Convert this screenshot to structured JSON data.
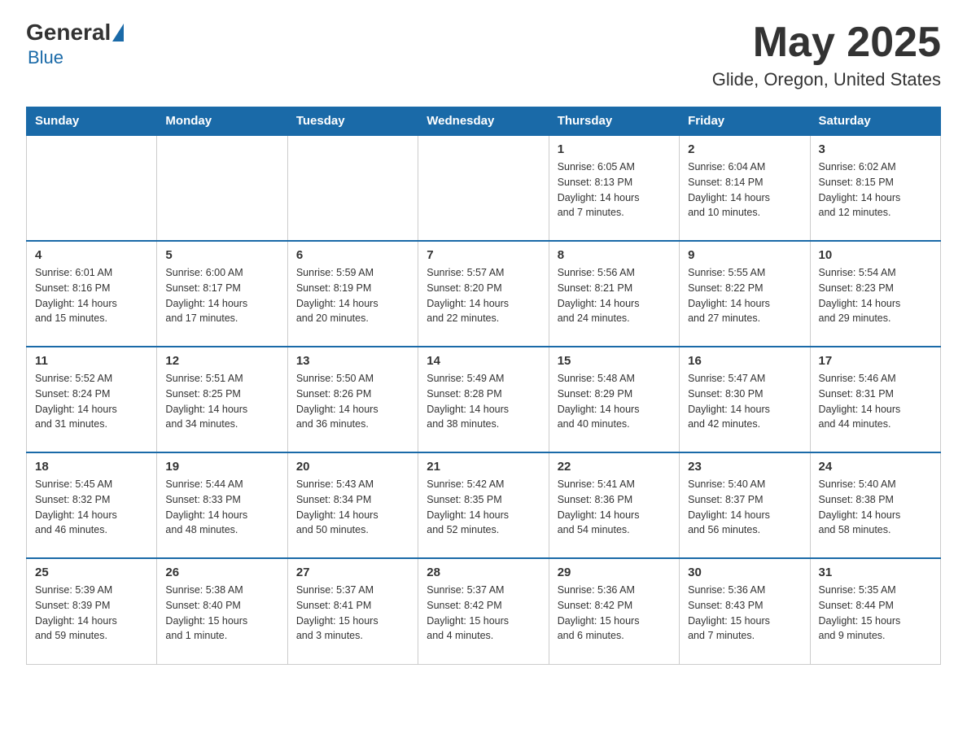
{
  "header": {
    "logo_general": "General",
    "logo_blue": "Blue",
    "month_title": "May 2025",
    "location": "Glide, Oregon, United States"
  },
  "days_of_week": [
    "Sunday",
    "Monday",
    "Tuesday",
    "Wednesday",
    "Thursday",
    "Friday",
    "Saturday"
  ],
  "weeks": [
    [
      {
        "day": "",
        "info": ""
      },
      {
        "day": "",
        "info": ""
      },
      {
        "day": "",
        "info": ""
      },
      {
        "day": "",
        "info": ""
      },
      {
        "day": "1",
        "info": "Sunrise: 6:05 AM\nSunset: 8:13 PM\nDaylight: 14 hours\nand 7 minutes."
      },
      {
        "day": "2",
        "info": "Sunrise: 6:04 AM\nSunset: 8:14 PM\nDaylight: 14 hours\nand 10 minutes."
      },
      {
        "day": "3",
        "info": "Sunrise: 6:02 AM\nSunset: 8:15 PM\nDaylight: 14 hours\nand 12 minutes."
      }
    ],
    [
      {
        "day": "4",
        "info": "Sunrise: 6:01 AM\nSunset: 8:16 PM\nDaylight: 14 hours\nand 15 minutes."
      },
      {
        "day": "5",
        "info": "Sunrise: 6:00 AM\nSunset: 8:17 PM\nDaylight: 14 hours\nand 17 minutes."
      },
      {
        "day": "6",
        "info": "Sunrise: 5:59 AM\nSunset: 8:19 PM\nDaylight: 14 hours\nand 20 minutes."
      },
      {
        "day": "7",
        "info": "Sunrise: 5:57 AM\nSunset: 8:20 PM\nDaylight: 14 hours\nand 22 minutes."
      },
      {
        "day": "8",
        "info": "Sunrise: 5:56 AM\nSunset: 8:21 PM\nDaylight: 14 hours\nand 24 minutes."
      },
      {
        "day": "9",
        "info": "Sunrise: 5:55 AM\nSunset: 8:22 PM\nDaylight: 14 hours\nand 27 minutes."
      },
      {
        "day": "10",
        "info": "Sunrise: 5:54 AM\nSunset: 8:23 PM\nDaylight: 14 hours\nand 29 minutes."
      }
    ],
    [
      {
        "day": "11",
        "info": "Sunrise: 5:52 AM\nSunset: 8:24 PM\nDaylight: 14 hours\nand 31 minutes."
      },
      {
        "day": "12",
        "info": "Sunrise: 5:51 AM\nSunset: 8:25 PM\nDaylight: 14 hours\nand 34 minutes."
      },
      {
        "day": "13",
        "info": "Sunrise: 5:50 AM\nSunset: 8:26 PM\nDaylight: 14 hours\nand 36 minutes."
      },
      {
        "day": "14",
        "info": "Sunrise: 5:49 AM\nSunset: 8:28 PM\nDaylight: 14 hours\nand 38 minutes."
      },
      {
        "day": "15",
        "info": "Sunrise: 5:48 AM\nSunset: 8:29 PM\nDaylight: 14 hours\nand 40 minutes."
      },
      {
        "day": "16",
        "info": "Sunrise: 5:47 AM\nSunset: 8:30 PM\nDaylight: 14 hours\nand 42 minutes."
      },
      {
        "day": "17",
        "info": "Sunrise: 5:46 AM\nSunset: 8:31 PM\nDaylight: 14 hours\nand 44 minutes."
      }
    ],
    [
      {
        "day": "18",
        "info": "Sunrise: 5:45 AM\nSunset: 8:32 PM\nDaylight: 14 hours\nand 46 minutes."
      },
      {
        "day": "19",
        "info": "Sunrise: 5:44 AM\nSunset: 8:33 PM\nDaylight: 14 hours\nand 48 minutes."
      },
      {
        "day": "20",
        "info": "Sunrise: 5:43 AM\nSunset: 8:34 PM\nDaylight: 14 hours\nand 50 minutes."
      },
      {
        "day": "21",
        "info": "Sunrise: 5:42 AM\nSunset: 8:35 PM\nDaylight: 14 hours\nand 52 minutes."
      },
      {
        "day": "22",
        "info": "Sunrise: 5:41 AM\nSunset: 8:36 PM\nDaylight: 14 hours\nand 54 minutes."
      },
      {
        "day": "23",
        "info": "Sunrise: 5:40 AM\nSunset: 8:37 PM\nDaylight: 14 hours\nand 56 minutes."
      },
      {
        "day": "24",
        "info": "Sunrise: 5:40 AM\nSunset: 8:38 PM\nDaylight: 14 hours\nand 58 minutes."
      }
    ],
    [
      {
        "day": "25",
        "info": "Sunrise: 5:39 AM\nSunset: 8:39 PM\nDaylight: 14 hours\nand 59 minutes."
      },
      {
        "day": "26",
        "info": "Sunrise: 5:38 AM\nSunset: 8:40 PM\nDaylight: 15 hours\nand 1 minute."
      },
      {
        "day": "27",
        "info": "Sunrise: 5:37 AM\nSunset: 8:41 PM\nDaylight: 15 hours\nand 3 minutes."
      },
      {
        "day": "28",
        "info": "Sunrise: 5:37 AM\nSunset: 8:42 PM\nDaylight: 15 hours\nand 4 minutes."
      },
      {
        "day": "29",
        "info": "Sunrise: 5:36 AM\nSunset: 8:42 PM\nDaylight: 15 hours\nand 6 minutes."
      },
      {
        "day": "30",
        "info": "Sunrise: 5:36 AM\nSunset: 8:43 PM\nDaylight: 15 hours\nand 7 minutes."
      },
      {
        "day": "31",
        "info": "Sunrise: 5:35 AM\nSunset: 8:44 PM\nDaylight: 15 hours\nand 9 minutes."
      }
    ]
  ]
}
